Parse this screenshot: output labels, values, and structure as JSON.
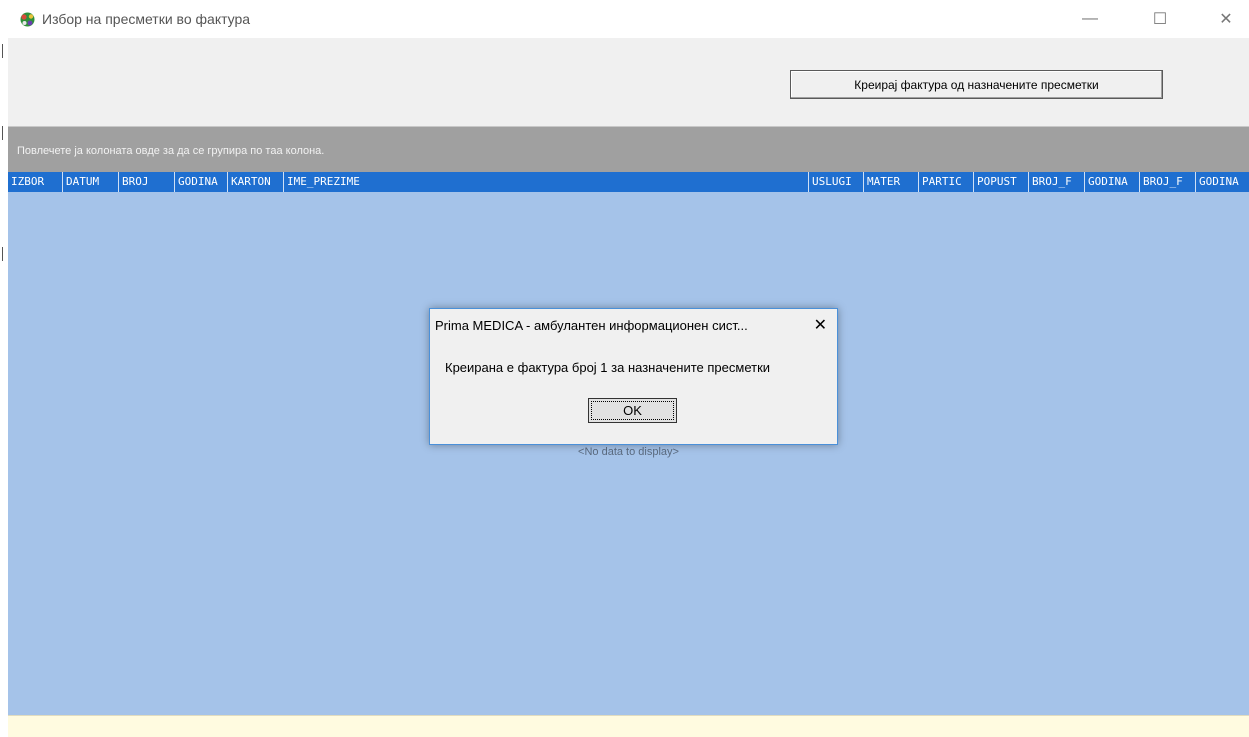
{
  "window": {
    "title": "Избор на пресметки во фактура",
    "icon": "app-flower-icon",
    "controls": {
      "minimize": "—",
      "maximize": "☐",
      "close": "✕"
    }
  },
  "toolbar": {
    "create_button_label": "Креирај фактура од назначените пресметки"
  },
  "group_panel": {
    "hint": "Повлечете ја колоната овде за да се групира по таа колона."
  },
  "grid": {
    "columns": [
      "IZBOR",
      "DATUM",
      "BROJ",
      "GODINA",
      "KARTON",
      "IME_PREZIME",
      "USLUGI",
      "MATER",
      "PARTIC",
      "POPUST",
      "BROJ_F",
      "GODINA",
      "BROJ_F",
      "GODINA"
    ],
    "empty_text": "<No data to display>"
  },
  "dialog": {
    "title": "Prima MEDICA - амбулантен информационен сист...",
    "close": "✕",
    "message": "Креирана е фактура број 1 за назначените пресметки",
    "ok_label": "OK"
  },
  "colors": {
    "header_blue": "#1f6fd0",
    "grid_body": "#a5c3e9",
    "group_panel": "#a0a0a0",
    "footer": "#fffbe0"
  }
}
